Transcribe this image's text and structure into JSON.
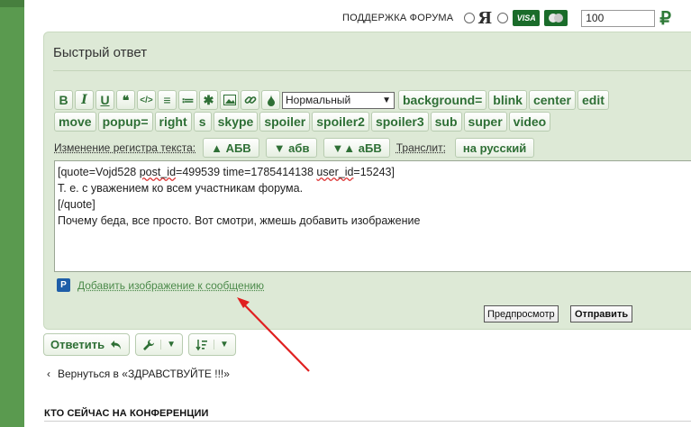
{
  "support": {
    "label": "ПОДДЕРЖКА ФОРУМА",
    "ya_label": "Я",
    "visa_label": "VISA",
    "amount_value": "100",
    "currency": "₽"
  },
  "quick_reply": {
    "title": "Быстрый ответ",
    "toolbar": {
      "format_buttons": [
        {
          "name": "bold-button",
          "label": "B"
        },
        {
          "name": "italic-button",
          "label": "I"
        },
        {
          "name": "underline-button",
          "label": "U"
        },
        {
          "name": "quote-button",
          "label": "❝"
        },
        {
          "name": "code-button",
          "label": "</>"
        },
        {
          "name": "list-button",
          "label": "≡"
        },
        {
          "name": "ordered-list-button",
          "label": "≔"
        },
        {
          "name": "asterisk-button",
          "label": "✱"
        },
        {
          "name": "image-button",
          "label": "▣"
        },
        {
          "name": "link-button",
          "label": "🔗"
        },
        {
          "name": "color-button",
          "label": "●"
        }
      ],
      "size_select_value": "Нормальный",
      "row1_text_buttons": [
        "background=",
        "blink",
        "center",
        "edit"
      ],
      "row2_text_buttons": [
        "move",
        "popup=",
        "right",
        "s",
        "skype",
        "spoiler",
        "spoiler2",
        "spoiler3",
        "sub",
        "super",
        "video"
      ]
    },
    "case_label": "Изменение регистра текста:",
    "case_buttons": [
      "▲ АБВ",
      "▼ абв",
      "▼▲ аБВ"
    ],
    "translit_label": "Транслит:",
    "translit_button": "на русский",
    "editor": {
      "line1_pre": "[quote=Vojd528 ",
      "line1_squig1": "post_id",
      "line1_mid": "=499539 time=1785414138 ",
      "line1_squig2": "user_id",
      "line1_post": "=15243]",
      "line2": "Т. е. с уважением ко всем участникам форума.",
      "line3": "[/quote]",
      "line4": "Почему беда, все просто. Вот смотри, жмешь добавить изображение"
    },
    "add_image_icon": "P",
    "add_image_link": "Добавить изображение к сообщению",
    "preview_button": "Предпросмотр",
    "send_button": "Отправить"
  },
  "actions": {
    "reply_label": "Ответить"
  },
  "back_link": "Вернуться в «ЗДРАВСТВУЙТЕ !!!»",
  "online_title": "КТО СЕЙЧАС НА КОНФЕРЕНЦИИ",
  "colors": {
    "accent_green": "#2e6f35",
    "panel_bg": "#dde9d6",
    "annotation_red": "#e02020"
  }
}
